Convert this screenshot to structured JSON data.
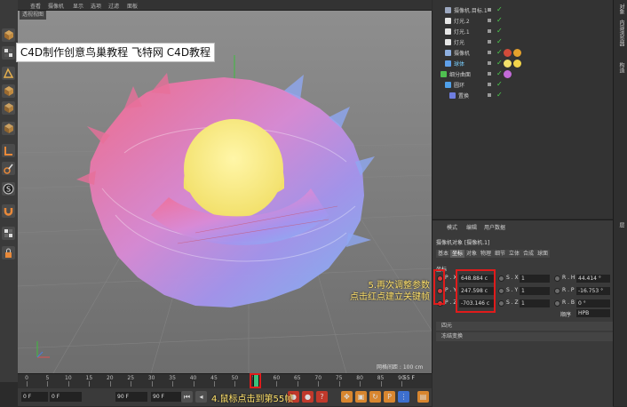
{
  "viewport": {
    "menu": [
      "查看",
      "摄像机",
      "显示",
      "选项",
      "过滤",
      "面板"
    ],
    "tab_label": "透视视图",
    "overlay_title": "C4D制作创意鸟巢教程 飞特网 C4D教程",
    "grid_spacing": "网格间距 : 100 cm",
    "annotation_params": [
      "5.再次调整参数",
      "点击红点建立关键帧"
    ]
  },
  "timeline": {
    "ticks": [
      "0",
      "5",
      "10",
      "15",
      "20",
      "25",
      "30",
      "35",
      "40",
      "45",
      "50",
      "55",
      "60",
      "65",
      "70",
      "75",
      "80",
      "85",
      "90"
    ],
    "current_frame_value": 55,
    "end_label": "55 F"
  },
  "transport": {
    "start_field": "0 F",
    "field2": "0 F",
    "field3": "90 F",
    "end_field": "90 F",
    "annotation_frame": "4.鼠标点击到第55帧",
    "accent_red": "#e01b1b",
    "annotation_color": "#ffe16b"
  },
  "object_manager": {
    "rows": [
      {
        "name": "摄像机.目标.1",
        "indent": 2,
        "icon": "camera-target-icon",
        "color": "#cfcfcf"
      },
      {
        "name": "灯光.2",
        "indent": 2,
        "icon": "light-icon",
        "color": "#cfcfcf"
      },
      {
        "name": "灯光.1",
        "indent": 2,
        "icon": "light-icon",
        "color": "#cfcfcf"
      },
      {
        "name": "灯光",
        "indent": 2,
        "icon": "light-icon",
        "color": "#cfcfcf"
      },
      {
        "name": "摄像机",
        "indent": 2,
        "icon": "camera-icon",
        "color": "#cfcfcf"
      },
      {
        "name": "球体",
        "indent": 2,
        "icon": "sphere-icon",
        "color": "#7ad0ff"
      },
      {
        "name": "细分曲面",
        "indent": 1,
        "icon": "subdivision-icon",
        "color": "#cfcfcf"
      },
      {
        "name": "圆环",
        "indent": 2,
        "icon": "torus-icon",
        "color": "#cfcfcf"
      },
      {
        "name": "置换",
        "indent": 3,
        "icon": "displacer-icon",
        "color": "#cfcfcf"
      }
    ]
  },
  "right_tabs": [
    "对象",
    "内容浏览器",
    "构造",
    "层"
  ],
  "attributes": {
    "menu": [
      "模式",
      "编辑",
      "用户数据"
    ],
    "object_title": "摄像机对象 [摄像机.1]",
    "tabs": [
      "基本",
      "坐标",
      "对象",
      "物理",
      "细节",
      "立体",
      "合成",
      "球面"
    ],
    "active_tab": "坐标",
    "section": "坐标",
    "coords": [
      {
        "p_label": "P . X",
        "p_value": "648.884 c",
        "s_label": "S . X",
        "s_value": "1",
        "r_label": "R . H",
        "r_value": "44.414 °"
      },
      {
        "p_label": "P . Y",
        "p_value": "247.598 c",
        "s_label": "S . Y",
        "s_value": "1",
        "r_label": "R . P",
        "r_value": "-16.753 °"
      },
      {
        "p_label": "P . Z",
        "p_value": "-703.146 c",
        "s_label": "S . Z",
        "s_value": "1",
        "r_label": "R . B",
        "r_value": "0 °"
      }
    ],
    "order_label": "顺序",
    "order_value": "HPB",
    "collapsed": [
      "四元",
      "冻结变换"
    ]
  }
}
